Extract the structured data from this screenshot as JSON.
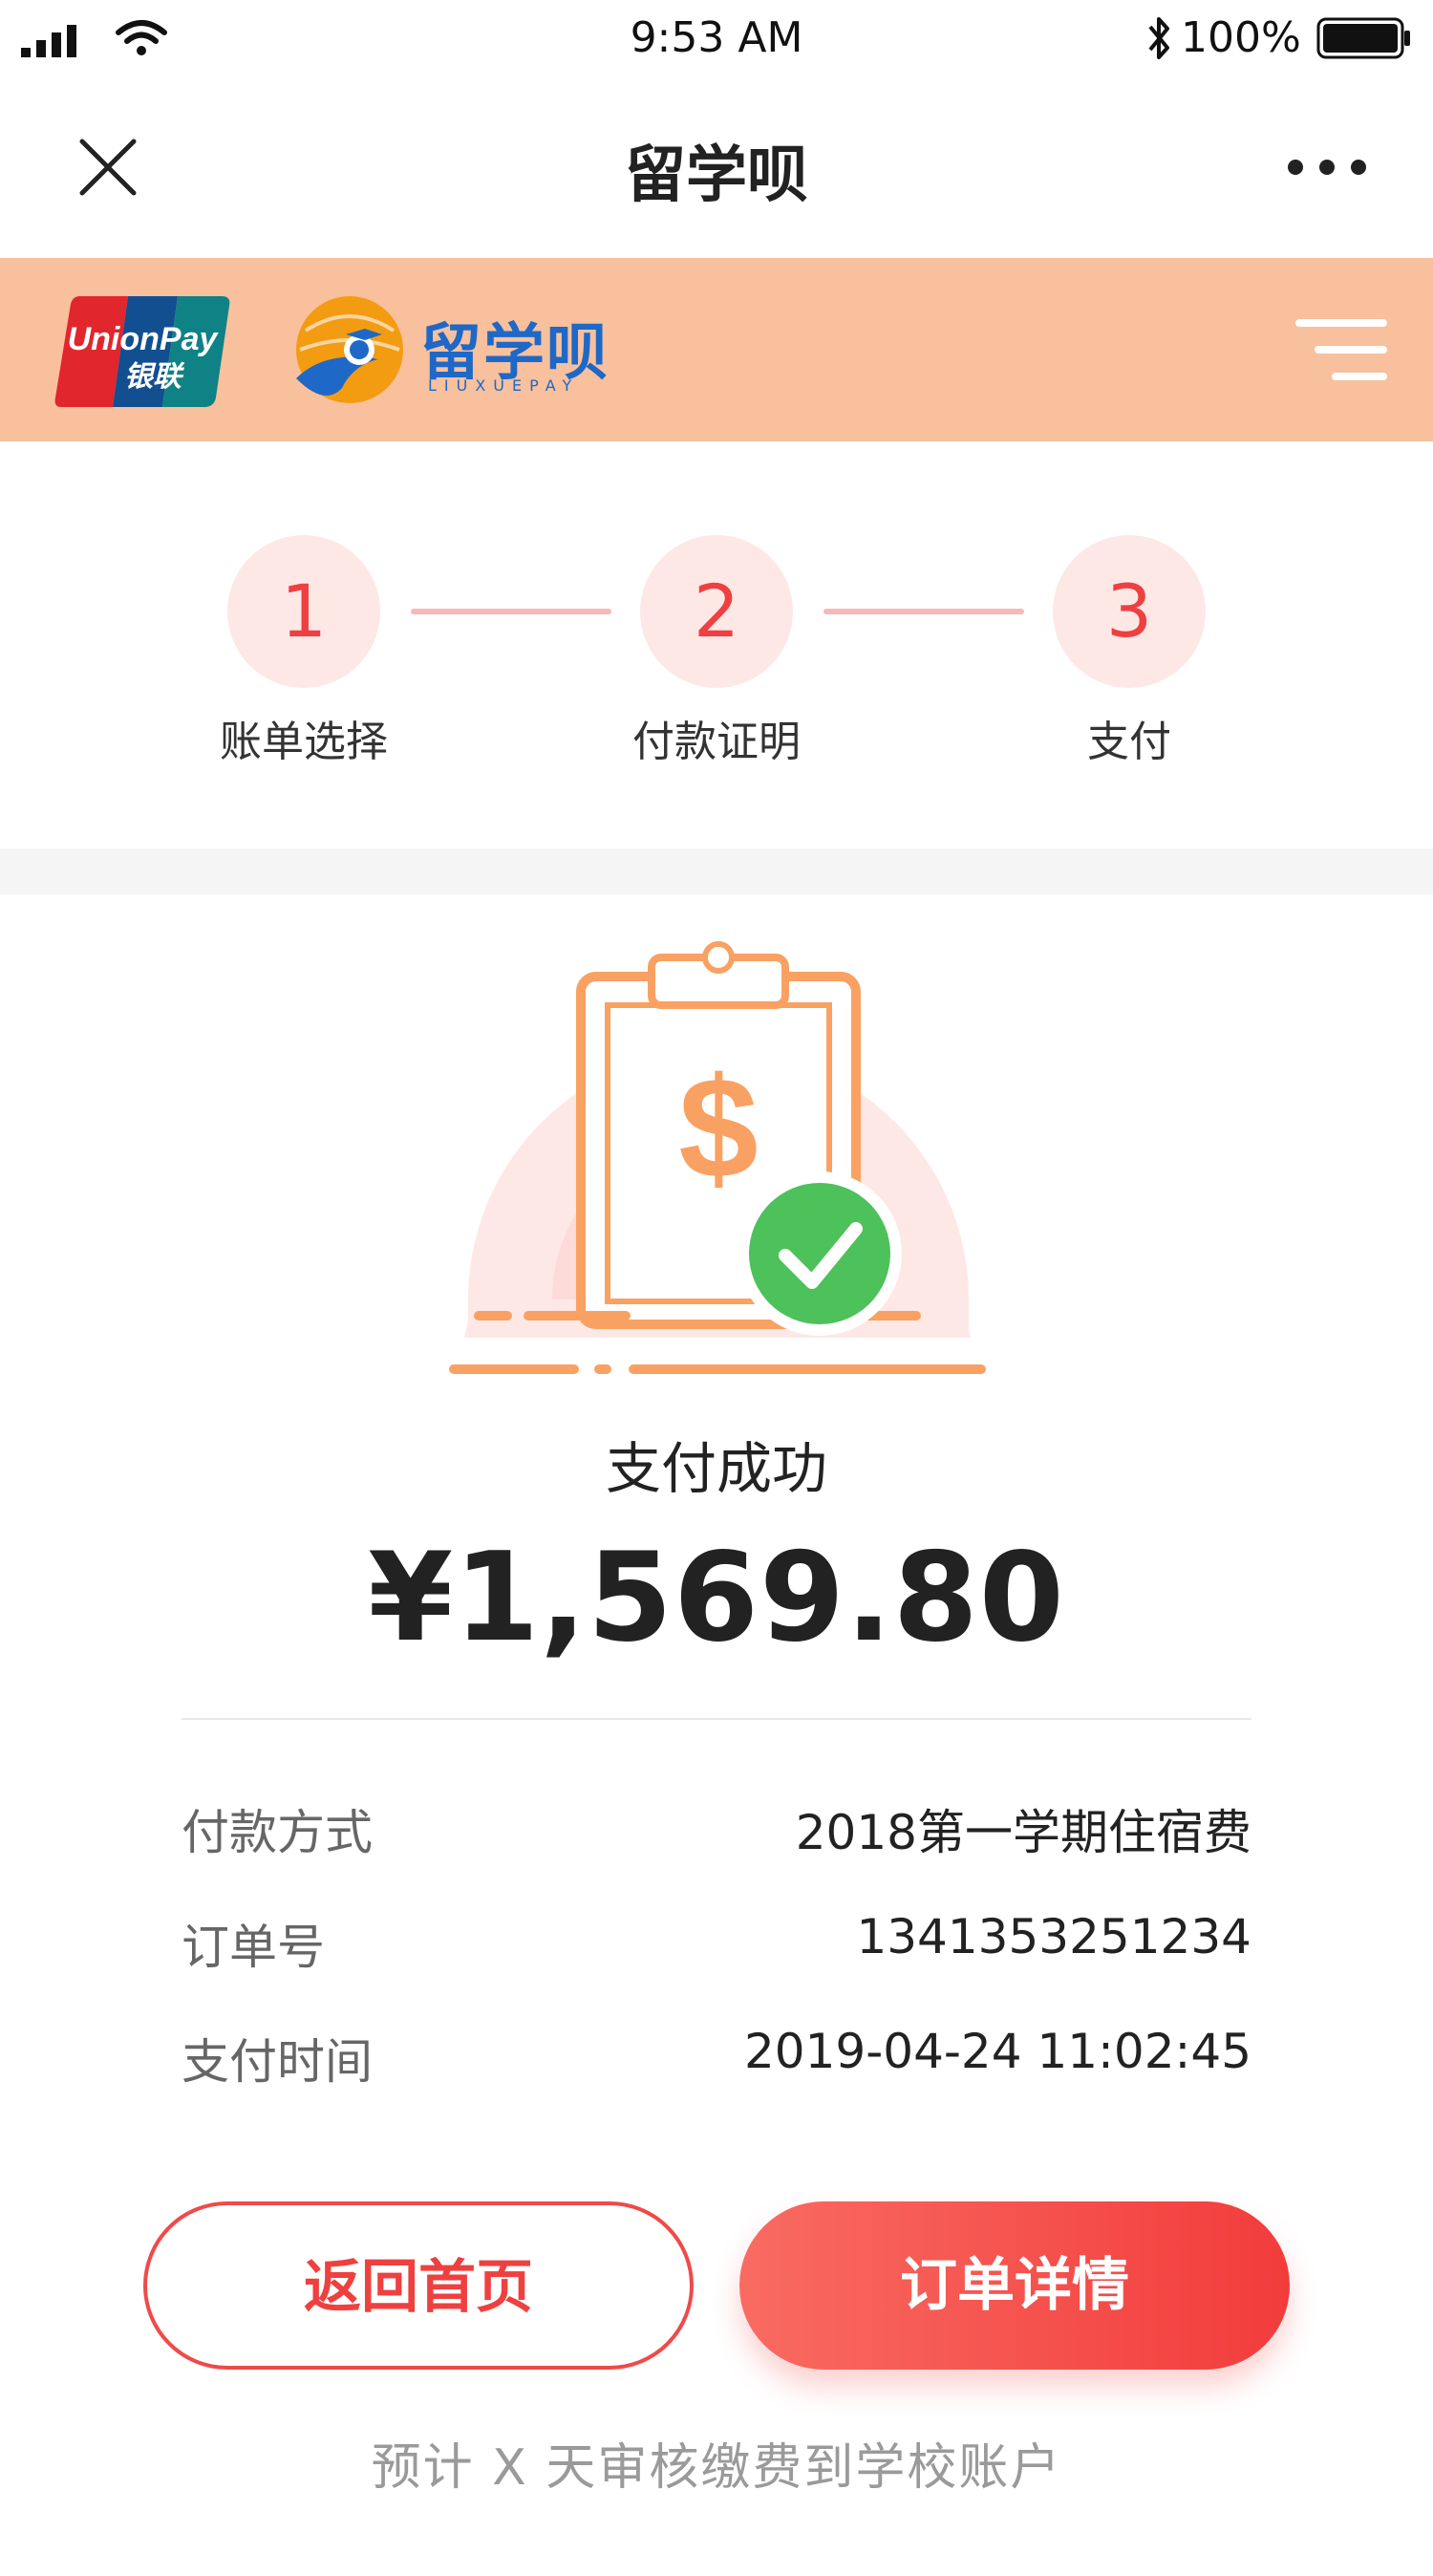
{
  "status_bar": {
    "time": "9:53 AM",
    "battery": "100%",
    "icons": [
      "signal-icon",
      "wifi-icon",
      "bluetooth-icon",
      "battery-icon"
    ]
  },
  "nav": {
    "title": "留学呗",
    "close_icon": "close-icon",
    "more_icon": "more-icon"
  },
  "brand": {
    "unionpay_text": "UnionPay",
    "unionpay_cn": "银联",
    "logo_text": "留学呗",
    "logo_sub": "LIUXUEPAY",
    "menu_icon": "menu-icon",
    "color": "#f8c09c"
  },
  "steps": [
    {
      "number": "1",
      "label": "账单选择"
    },
    {
      "number": "2",
      "label": "付款证明"
    },
    {
      "number": "3",
      "label": "支付"
    }
  ],
  "result": {
    "status": "支付成功",
    "amount": "¥1,569.80",
    "icon": "payment-success-illustration"
  },
  "details": [
    {
      "label": "付款方式",
      "value": "2018第一学期住宿费"
    },
    {
      "label": "订单号",
      "value": "1341353251234"
    },
    {
      "label": "支付时间",
      "value": "2019-04-24 11:02:45"
    }
  ],
  "buttons": {
    "home": "返回首页",
    "order_detail": "订单详情"
  },
  "footnote": "预计 X 天审核缴费到学校账户",
  "colors": {
    "accent": "#ef4040",
    "success": "#4dc15a",
    "orange": "#f9a162"
  }
}
